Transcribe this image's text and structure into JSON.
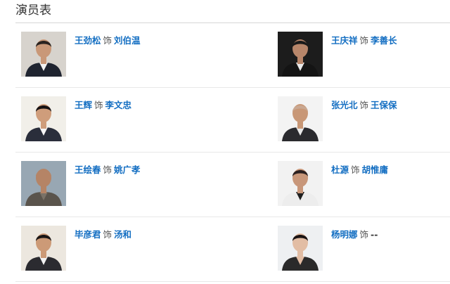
{
  "section": {
    "title": "演员表"
  },
  "cast": [
    {
      "actor": "王劲松",
      "as": "饰",
      "role": "刘伯温",
      "role_link": true,
      "photo": {
        "bg": "#d7d3cd",
        "skin": "#c99878",
        "hair": "#2a2320",
        "clothes": "#1f2430",
        "shirt": "#f2f2f2"
      }
    },
    {
      "actor": "王庆祥",
      "as": "饰",
      "role": "李善长",
      "role_link": true,
      "photo": {
        "bg": "#1c1c1c",
        "skin": "#b8866a",
        "hair": "#1a1a1a",
        "clothes": "#141414",
        "shirt": "#e9e9e9"
      }
    },
    {
      "actor": "王辉",
      "as": "饰",
      "role": "李文忠",
      "role_link": true,
      "photo": {
        "bg": "#f1efe9",
        "skin": "#cf9d7b",
        "hair": "#161214",
        "clothes": "#2a2e3b",
        "shirt": "#f6f6f6"
      }
    },
    {
      "actor": "张光北",
      "as": "饰",
      "role": "王保保",
      "role_link": true,
      "photo": {
        "bg": "#f3f3f3",
        "skin": "#c89776",
        "hair": "#c9a892",
        "clothes": "#2a2a2e",
        "shirt": "#e8e8e8"
      }
    },
    {
      "actor": "王绘春",
      "as": "饰",
      "role": "姚广孝",
      "role_link": true,
      "photo": {
        "bg": "#98a7b3",
        "skin": "#b58466",
        "hair": "#b58466",
        "clothes": "#5a544c",
        "shirt": "#7a7267"
      }
    },
    {
      "actor": "杜源",
      "as": "饰",
      "role": "胡惟庸",
      "role_link": true,
      "photo": {
        "bg": "#f2f2f2",
        "skin": "#c8977a",
        "hair": "#2a2020",
        "clothes": "#ededed",
        "shirt": "#1f1f1f"
      }
    },
    {
      "actor": "毕彦君",
      "as": "饰",
      "role": "汤和",
      "role_link": true,
      "photo": {
        "bg": "#ece7df",
        "skin": "#cc9a77",
        "hair": "#1a1616",
        "clothes": "#2b2b30",
        "shirt": "#f2f2f2"
      }
    },
    {
      "actor": "杨明娜",
      "as": "饰",
      "role": "--",
      "role_link": false,
      "photo": {
        "bg": "#eef0f2",
        "skin": "#e2bda4",
        "hair": "#1a1414",
        "clothes": "#2a2a2a",
        "shirt": "#e2bda4"
      }
    }
  ]
}
